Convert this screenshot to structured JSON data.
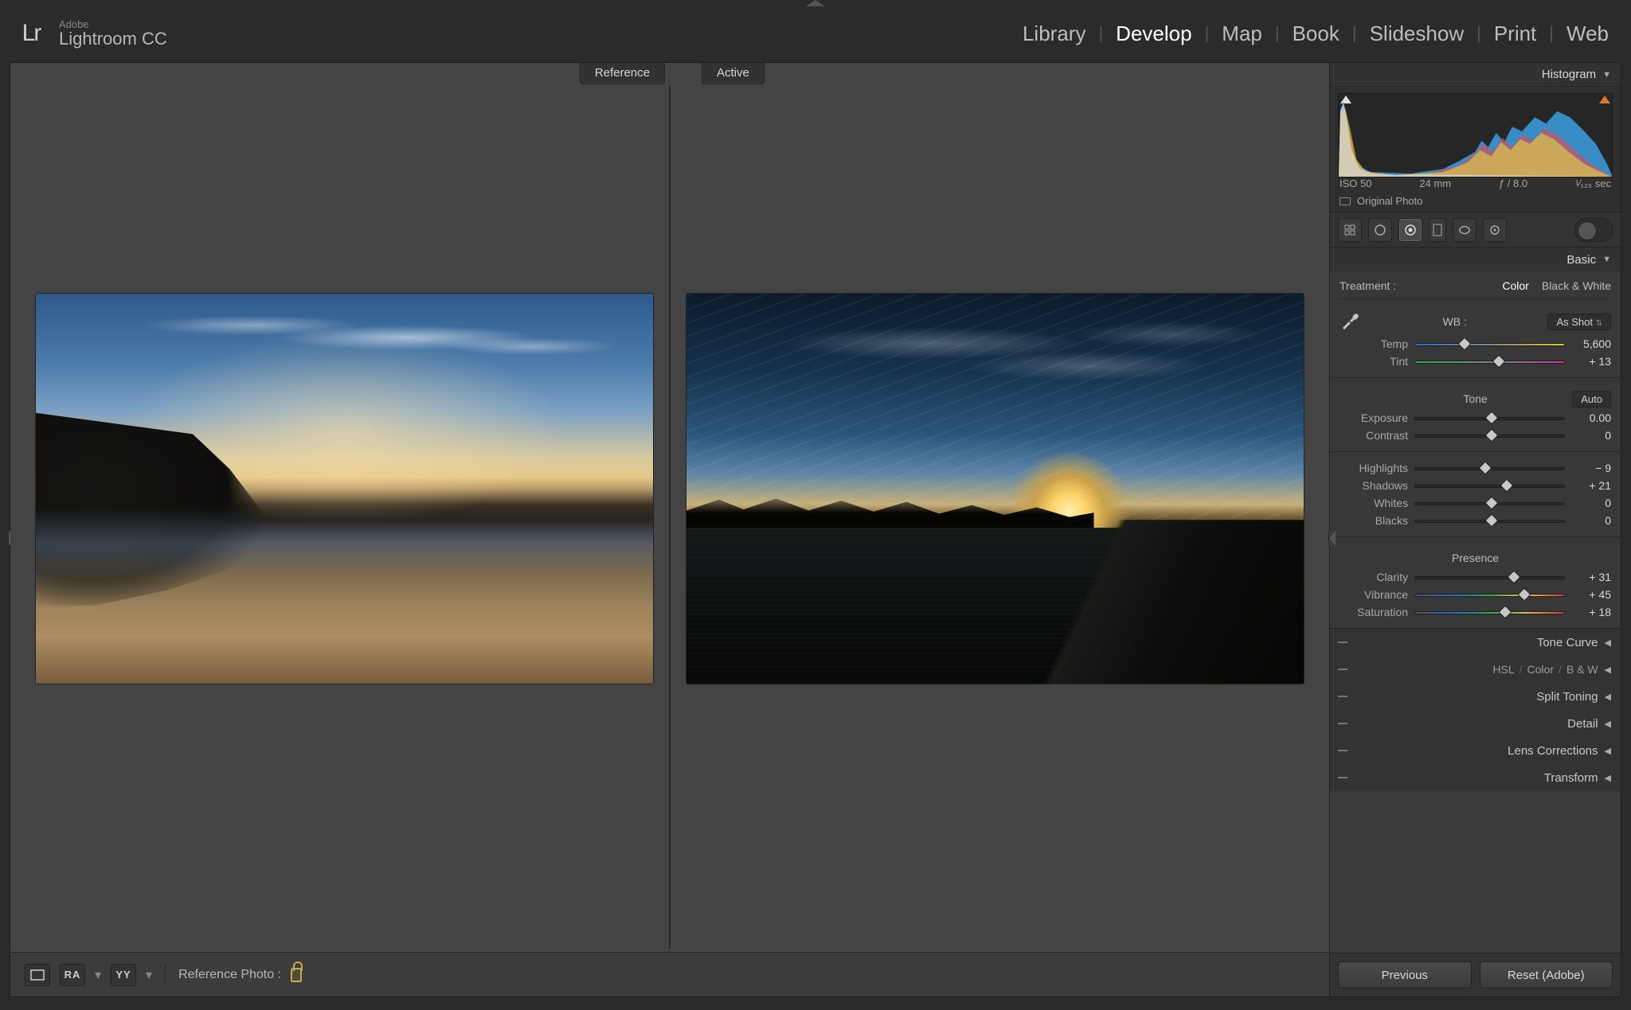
{
  "brand": {
    "adobe": "Adobe",
    "name": "Lightroom CC",
    "logo": "Lr"
  },
  "modules": [
    "Library",
    "Develop",
    "Map",
    "Book",
    "Slideshow",
    "Print",
    "Web"
  ],
  "active_module": "Develop",
  "view": {
    "reference": "Reference",
    "active": "Active"
  },
  "bottom": {
    "reference_label": "Reference Photo :",
    "btn_ra": "RA",
    "btn_yy": "YY"
  },
  "right": {
    "histogram": {
      "title": "Histogram",
      "iso": "ISO 50",
      "focal": "24 mm",
      "aperture": "ƒ / 8.0",
      "shutter": "¹⁄₁₂₅ sec",
      "original": "Original Photo"
    },
    "basic": {
      "title": "Basic",
      "treatment_label": "Treatment :",
      "treatment_color": "Color",
      "treatment_bw": "Black & White",
      "wb_label": "WB :",
      "wb_value": "As Shot",
      "temp_label": "Temp",
      "temp_value": "5,600",
      "tint_label": "Tint",
      "tint_value": "+ 13",
      "tone_title": "Tone",
      "auto": "Auto",
      "exposure_label": "Exposure",
      "exposure_value": "0.00",
      "contrast_label": "Contrast",
      "contrast_value": "0",
      "highlights_label": "Highlights",
      "highlights_value": "− 9",
      "shadows_label": "Shadows",
      "shadows_value": "+ 21",
      "whites_label": "Whites",
      "whites_value": "0",
      "blacks_label": "Blacks",
      "blacks_value": "0",
      "presence_title": "Presence",
      "clarity_label": "Clarity",
      "clarity_value": "+ 31",
      "vibrance_label": "Vibrance",
      "vibrance_value": "+ 45",
      "saturation_label": "Saturation",
      "saturation_value": "+ 18"
    },
    "sections": {
      "tone_curve": "Tone Curve",
      "hsl": "HSL",
      "color": "Color",
      "bw": "B & W",
      "split": "Split Toning",
      "detail": "Detail",
      "lens": "Lens Corrections",
      "transform": "Transform"
    },
    "footer": {
      "previous": "Previous",
      "reset": "Reset (Adobe)"
    }
  }
}
